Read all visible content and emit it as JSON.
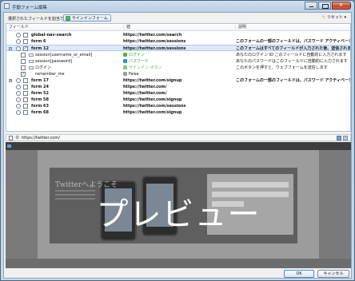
{
  "window": {
    "title": "手動フォーム編集"
  },
  "toolbar": {
    "label": "選択されたフィールドを割当て:",
    "signin_button": "サインインフォーム",
    "reset_button": "リセット"
  },
  "grid": {
    "headers": {
      "field": "フィールド",
      "value": "値",
      "description": "説明"
    },
    "rows": [
      {
        "name": "global-nav-search",
        "value": "https://twitter.com/search",
        "desc": ""
      },
      {
        "name": "form 6",
        "value": "https://twitter.com/sessions",
        "desc": "このフォームの一部のフィールドは、パスワード アクティベーシ..."
      },
      {
        "name": "form 12",
        "value": "https://twitter.com/sessions",
        "desc": "このフォームはすべてのフィールドが入力された後、送信されます"
      },
      {
        "name": "session[username_or_email]",
        "value": "ログイン",
        "desc": "あなたのログイン ID このフィールドに自動的に入力されます"
      },
      {
        "name": "session[password]",
        "value": "パスワード",
        "desc": "あなたのパスワードはこのフィールドに自動的に入力されます"
      },
      {
        "name": "ログイン",
        "value": "サインイン ボタン",
        "desc": "このボタンを押すと、ウェブフォームを送信します"
      },
      {
        "name": "remember_me",
        "value": "False",
        "desc": ""
      },
      {
        "name": "form 17",
        "value": "https://twitter.com/signup",
        "desc": "このフォームの一部のフィールドは、パスワード アクティベーシ..."
      },
      {
        "name": "form 24",
        "value": "https://twitter.com/",
        "desc": ""
      },
      {
        "name": "form 52",
        "value": "https://twitter.com/",
        "desc": ""
      },
      {
        "name": "form 58",
        "value": "https://twitter.com/signup",
        "desc": ""
      },
      {
        "name": "form 63",
        "value": "https://twitter.com/sessions",
        "desc": ""
      },
      {
        "name": "form 68",
        "value": "https://twitter.com/signup",
        "desc": ""
      }
    ]
  },
  "address": {
    "url": "https://twitter.com/"
  },
  "preview": {
    "overlay_text": "プレビュー",
    "page_heading": "Twitterへようこそ"
  },
  "footer": {
    "ok": "OK",
    "cancel": "キャンセル"
  },
  "colors": {
    "accent": "#3e8de0",
    "selected_row": "#dbe9f8",
    "value_green": "#3a9a34"
  }
}
